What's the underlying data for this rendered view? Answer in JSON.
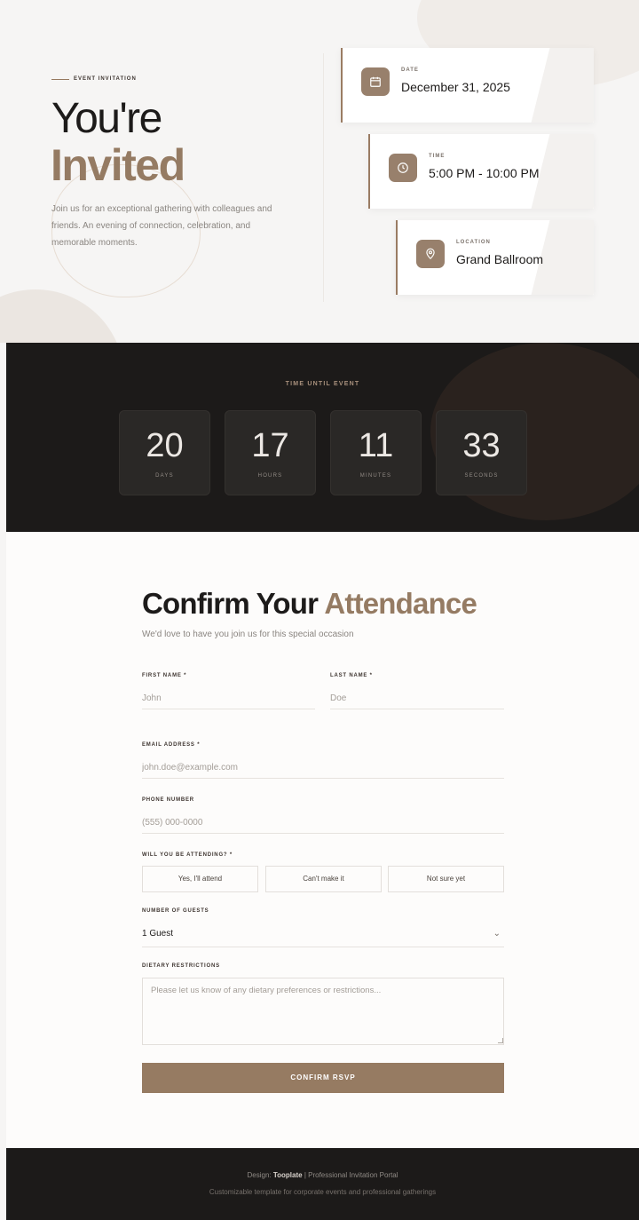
{
  "hero": {
    "eyebrow": "EVENT INVITATION",
    "title_line1": "You're",
    "title_line2": "Invited",
    "intro": "Join us for an exceptional gathering with colleagues and friends. An evening of connection, celebration, and memorable moments."
  },
  "details": [
    {
      "label": "DATE",
      "value": "December 31, 2025",
      "icon": "calendar-icon"
    },
    {
      "label": "TIME",
      "value": "5:00 PM - 10:00 PM",
      "icon": "clock-icon"
    },
    {
      "label": "LOCATION",
      "value": "Grand Ballroom",
      "icon": "map-pin-icon"
    }
  ],
  "countdown": {
    "title": "TIME UNTIL EVENT",
    "units": [
      {
        "value": "20",
        "label": "DAYS"
      },
      {
        "value": "17",
        "label": "HOURS"
      },
      {
        "value": "11",
        "label": "MINUTES"
      },
      {
        "value": "33",
        "label": "SECONDS"
      }
    ]
  },
  "rsvp": {
    "title_plain": "Confirm Your",
    "title_accent": "Attendance",
    "subtitle": "We'd love to have you join us for this special occasion",
    "first_name_label": "FIRST NAME *",
    "first_name_placeholder": "John",
    "last_name_label": "LAST NAME *",
    "last_name_placeholder": "Doe",
    "email_label": "EMAIL ADDRESS *",
    "email_placeholder": "john.doe@example.com",
    "phone_label": "PHONE NUMBER",
    "phone_placeholder": "(555) 000-0000",
    "attending_label": "WILL YOU BE ATTENDING? *",
    "attending_options": [
      "Yes, I'll attend",
      "Can't make it",
      "Not sure yet"
    ],
    "guests_label": "NUMBER OF GUESTS",
    "guests_value": "1 Guest",
    "dietary_label": "DIETARY RESTRICTIONS",
    "dietary_placeholder": "Please let us know of any dietary preferences or restrictions...",
    "submit_label": "CONFIRM RSVP"
  },
  "footer": {
    "design_prefix": "Design:",
    "brand": "Tooplate",
    "design_suffix": "| Professional Invitation Portal",
    "tagline": "Customizable template for corporate events and professional gatherings"
  },
  "colors": {
    "accent": "#967b62",
    "dark": "#1c1a19",
    "background": "#f6f5f4"
  }
}
